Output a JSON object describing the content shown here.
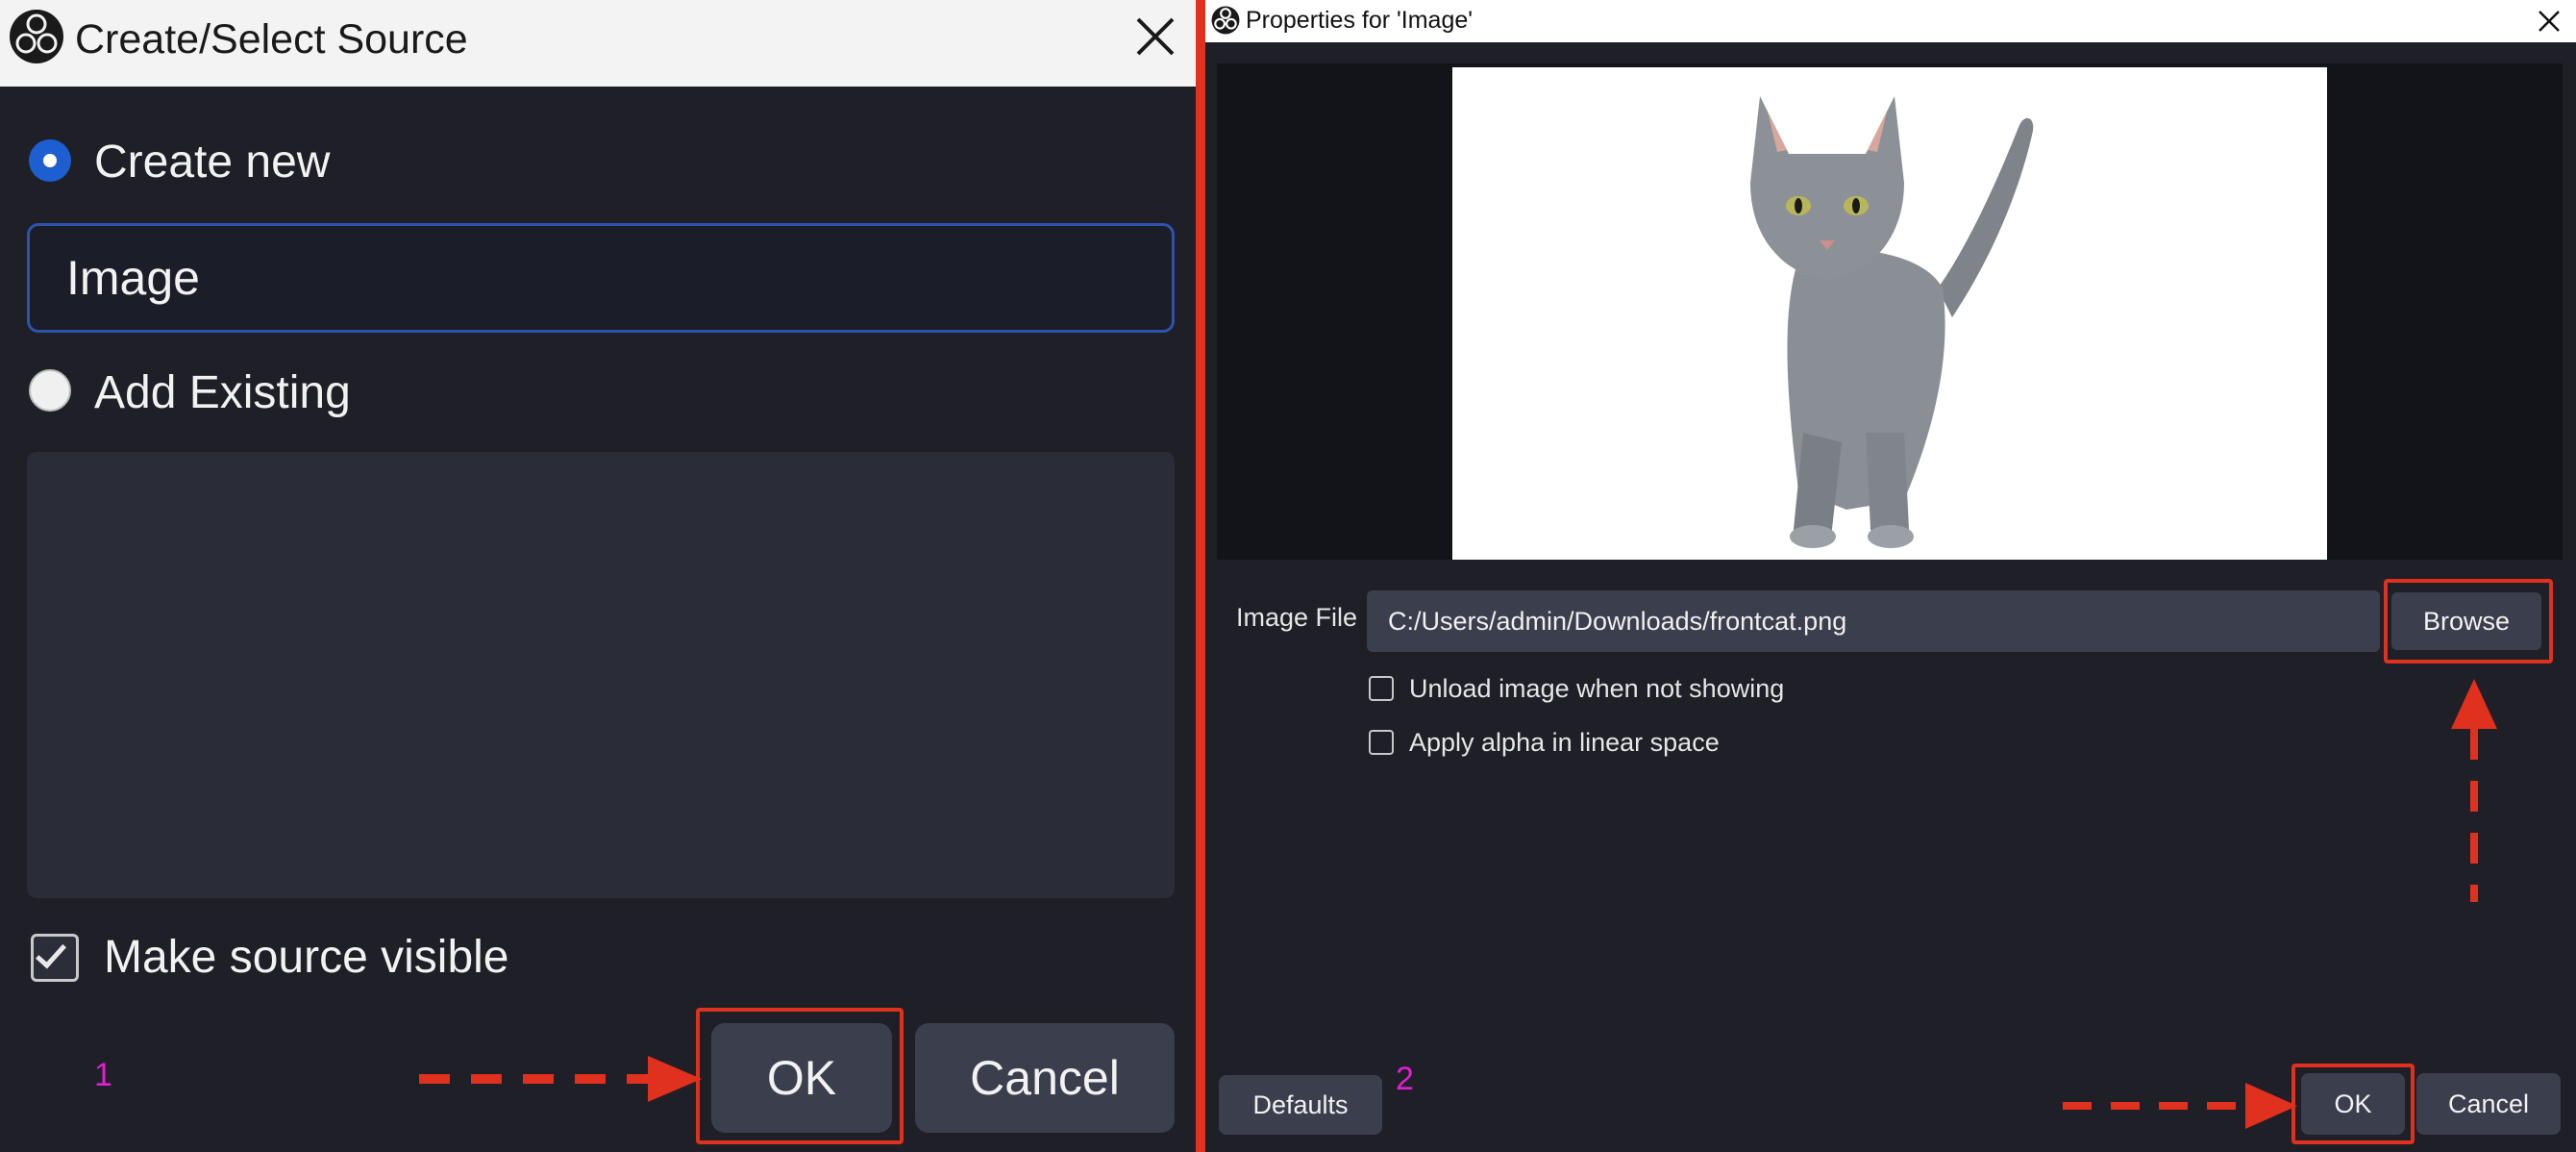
{
  "create_dialog": {
    "title": "Create/Select Source",
    "create_new_label": "Create new",
    "name_value": "Image",
    "add_existing_label": "Add Existing",
    "make_visible_label": "Make source visible",
    "ok_label": "OK",
    "cancel_label": "Cancel",
    "step_number": "1"
  },
  "properties_dialog": {
    "title": "Properties for 'Image'",
    "image_file_label": "Image File",
    "image_file_value": "C:/Users/admin/Downloads/frontcat.png",
    "browse_label": "Browse",
    "unload_label": "Unload image when not showing",
    "alpha_label": "Apply alpha in linear space",
    "defaults_label": "Defaults",
    "ok_label": "OK",
    "cancel_label": "Cancel",
    "step_number": "2"
  },
  "colors": {
    "highlight": "#e0301e",
    "step_number": "#e21fd0",
    "input_focus": "#2f52ab",
    "background": "#1e1f27",
    "button": "#3b3e4d"
  },
  "icons": {
    "app_logo": "obs-logo-icon",
    "close": "close-icon",
    "arrow": "dashed-arrow-icon"
  }
}
